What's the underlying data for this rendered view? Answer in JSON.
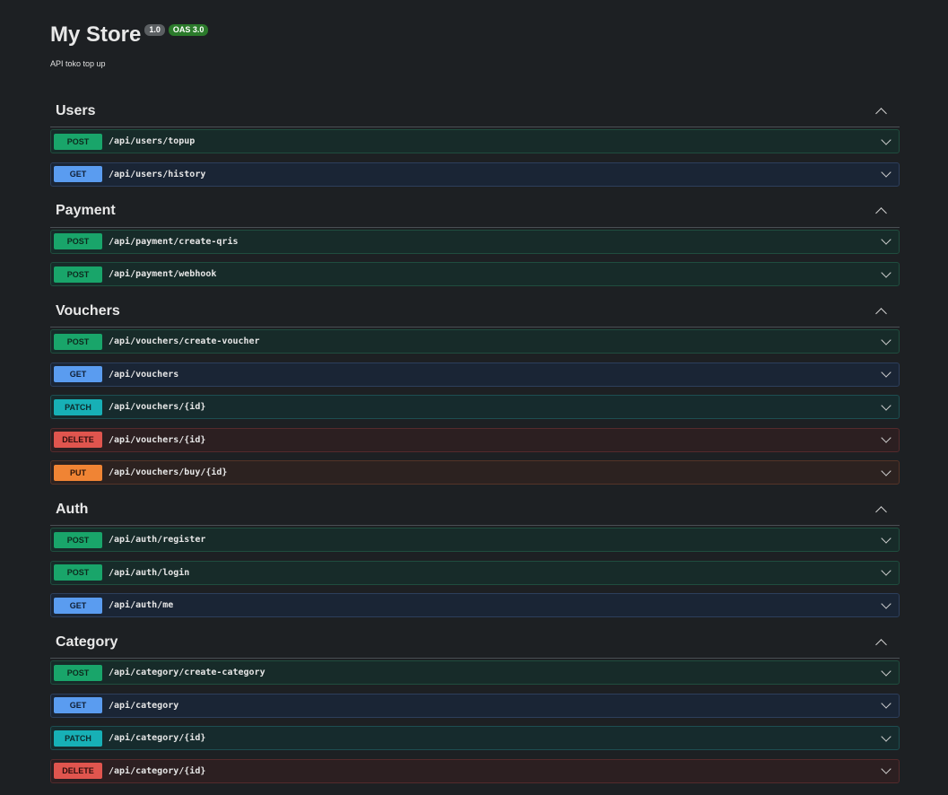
{
  "info": {
    "title": "My Store",
    "version": "1.0",
    "oas": "OAS 3.0",
    "description": "API toko top up"
  },
  "tags": [
    {
      "name": "Users",
      "operations": [
        {
          "method": "POST",
          "path": "/api/users/topup"
        },
        {
          "method": "GET",
          "path": "/api/users/history"
        }
      ]
    },
    {
      "name": "Payment",
      "operations": [
        {
          "method": "POST",
          "path": "/api/payment/create-qris"
        },
        {
          "method": "POST",
          "path": "/api/payment/webhook"
        }
      ]
    },
    {
      "name": "Vouchers",
      "operations": [
        {
          "method": "POST",
          "path": "/api/vouchers/create-voucher"
        },
        {
          "method": "GET",
          "path": "/api/vouchers"
        },
        {
          "method": "PATCH",
          "path": "/api/vouchers/{id}"
        },
        {
          "method": "DELETE",
          "path": "/api/vouchers/{id}"
        },
        {
          "method": "PUT",
          "path": "/api/vouchers/buy/{id}"
        }
      ]
    },
    {
      "name": "Auth",
      "operations": [
        {
          "method": "POST",
          "path": "/api/auth/register"
        },
        {
          "method": "POST",
          "path": "/api/auth/login"
        },
        {
          "method": "GET",
          "path": "/api/auth/me"
        }
      ]
    },
    {
      "name": "Category",
      "operations": [
        {
          "method": "POST",
          "path": "/api/category/create-category"
        },
        {
          "method": "GET",
          "path": "/api/category"
        },
        {
          "method": "PATCH",
          "path": "/api/category/{id}"
        },
        {
          "method": "DELETE",
          "path": "/api/category/{id}"
        }
      ]
    }
  ],
  "colors": {
    "background": "#1d2023",
    "post": "#19a56a",
    "get": "#5a9cf0",
    "patch": "#17b0b6",
    "delete": "#e0554e",
    "put": "#f08434"
  },
  "icons": {
    "tag_toggle": "chevron-up-icon",
    "op_toggle": "chevron-down-icon"
  }
}
